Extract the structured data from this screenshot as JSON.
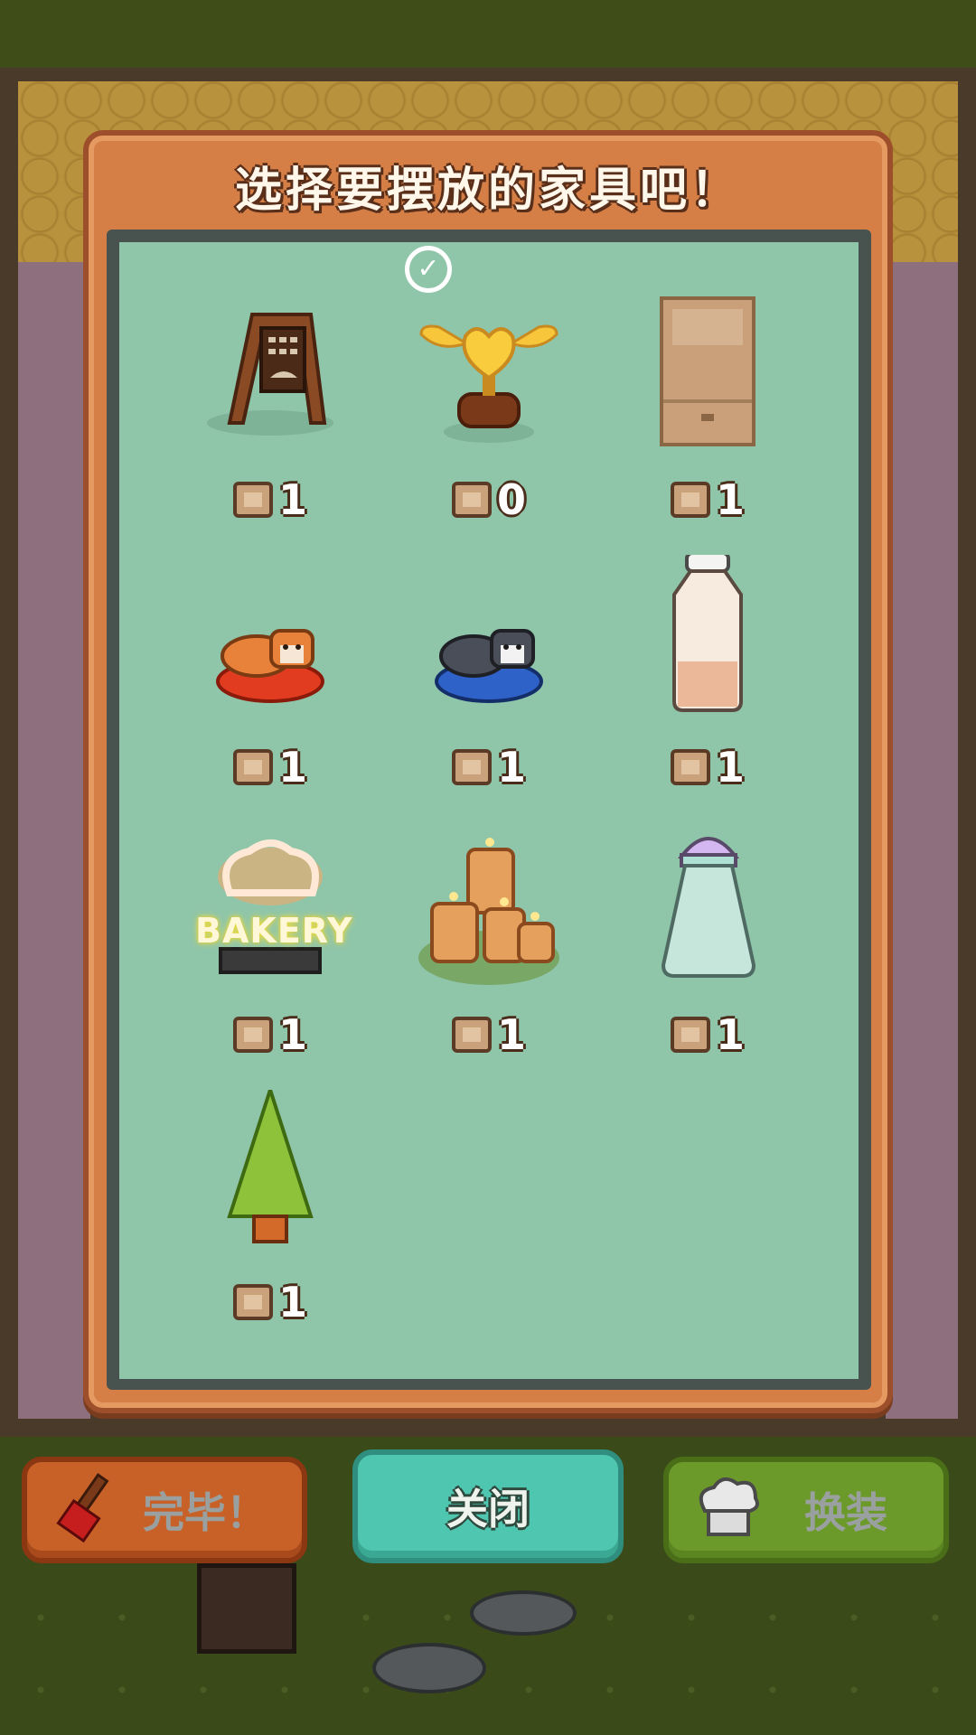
{
  "dialog": {
    "title": "选择要摆放的家具吧！"
  },
  "items": [
    {
      "name": "menu-sign",
      "count": "1",
      "selected": false
    },
    {
      "name": "golden-trophy",
      "count": "0",
      "selected": true
    },
    {
      "name": "cardboard-box",
      "count": "1",
      "selected": false
    },
    {
      "name": "shiba-cushion",
      "count": "1",
      "selected": false
    },
    {
      "name": "husky-cushion",
      "count": "1",
      "selected": false
    },
    {
      "name": "milk-bottle",
      "count": "1",
      "selected": false
    },
    {
      "name": "bakery-neon-sign",
      "label": "BAKERY",
      "count": "1",
      "selected": false
    },
    {
      "name": "candles",
      "count": "1",
      "selected": false
    },
    {
      "name": "salt-shaker",
      "count": "1",
      "selected": false
    },
    {
      "name": "pine-tree",
      "count": "1",
      "selected": false
    }
  ],
  "buttons": {
    "done": "完毕！",
    "close": "关闭",
    "dress": "换装"
  },
  "icons": {
    "count": "box-icon",
    "selected": "check-icon",
    "done": "paintbrush-icon",
    "dress": "chef-hat-icon"
  },
  "colors": {
    "panel": "#d57f47",
    "grid": "#8fc5a9",
    "close_button": "#4fc6b0",
    "done_button": "#c86128",
    "dress_button": "#6c9a2a"
  }
}
